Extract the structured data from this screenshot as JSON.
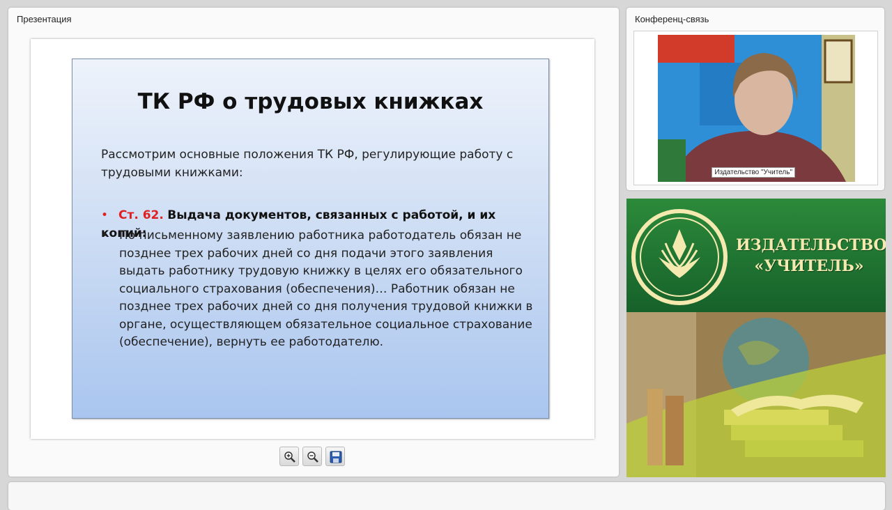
{
  "presentation": {
    "title": "Презентация",
    "slide": {
      "title": "ТК РФ о трудовых книжках",
      "intro": "Рассмотрим основные положения ТК РФ, регулирующие работу с трудовыми книжками:",
      "bullet_symbol": "•",
      "article_number": "Ст. 62.",
      "article_heading": "Выдача документов, связанных с работой, и их копий:",
      "body": "По письменному заявлению работника работодатель обязан не позднее трех рабочих дней со дня подачи этого заявления выдать работнику трудовую книжку в целях его обязательного социального страхования (обеспечения)… Работник обязан не позднее трех рабочих дней со дня получения трудовой книжки в органе, осуществляющем обязательное социальное страхование (обеспечение), вернуть ее работодателю."
    },
    "toolbar": {
      "zoom_in_icon": "zoom-in-icon",
      "zoom_out_icon": "zoom-out-icon",
      "save_icon": "save-icon"
    }
  },
  "conference": {
    "title": "Конференц-связь",
    "video_label": "Издательство \"Учитель\""
  },
  "banner": {
    "name_line1": "ИЗДАТЕЛЬСТВО",
    "name_line2": "«УЧИТЕЛЬ»"
  },
  "colors": {
    "accent_red": "#e02020",
    "banner_green": "#1f7a30",
    "banner_text": "#f4eab0"
  }
}
